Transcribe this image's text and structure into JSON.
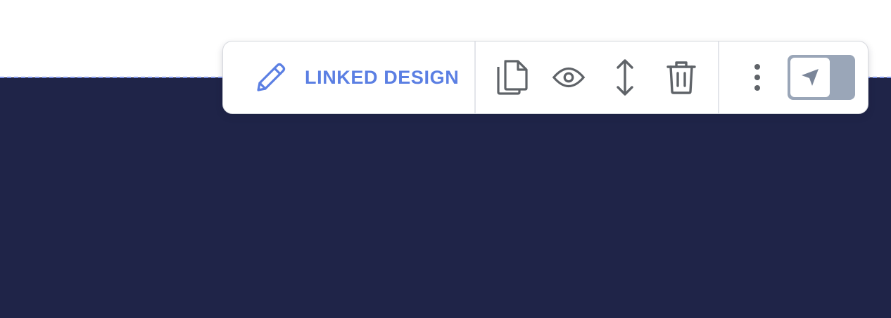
{
  "toolbar": {
    "edit": {
      "label": "LINKED DESIGN",
      "icon": "pencil-icon",
      "color": "#5b7fe3"
    },
    "actions": [
      {
        "name": "copy",
        "icon": "copy-icon"
      },
      {
        "name": "preview",
        "icon": "eye-icon"
      },
      {
        "name": "resize",
        "icon": "vertical-resize-icon"
      },
      {
        "name": "delete",
        "icon": "trash-icon"
      }
    ],
    "more_icon": "kebab-menu-icon",
    "toggle": {
      "icon": "send-arrow-icon",
      "state": "off"
    },
    "icon_color": "#5f6368"
  },
  "canvas": {
    "section_background": "#1f2448",
    "selection_outline_color": "#7f93e6"
  }
}
